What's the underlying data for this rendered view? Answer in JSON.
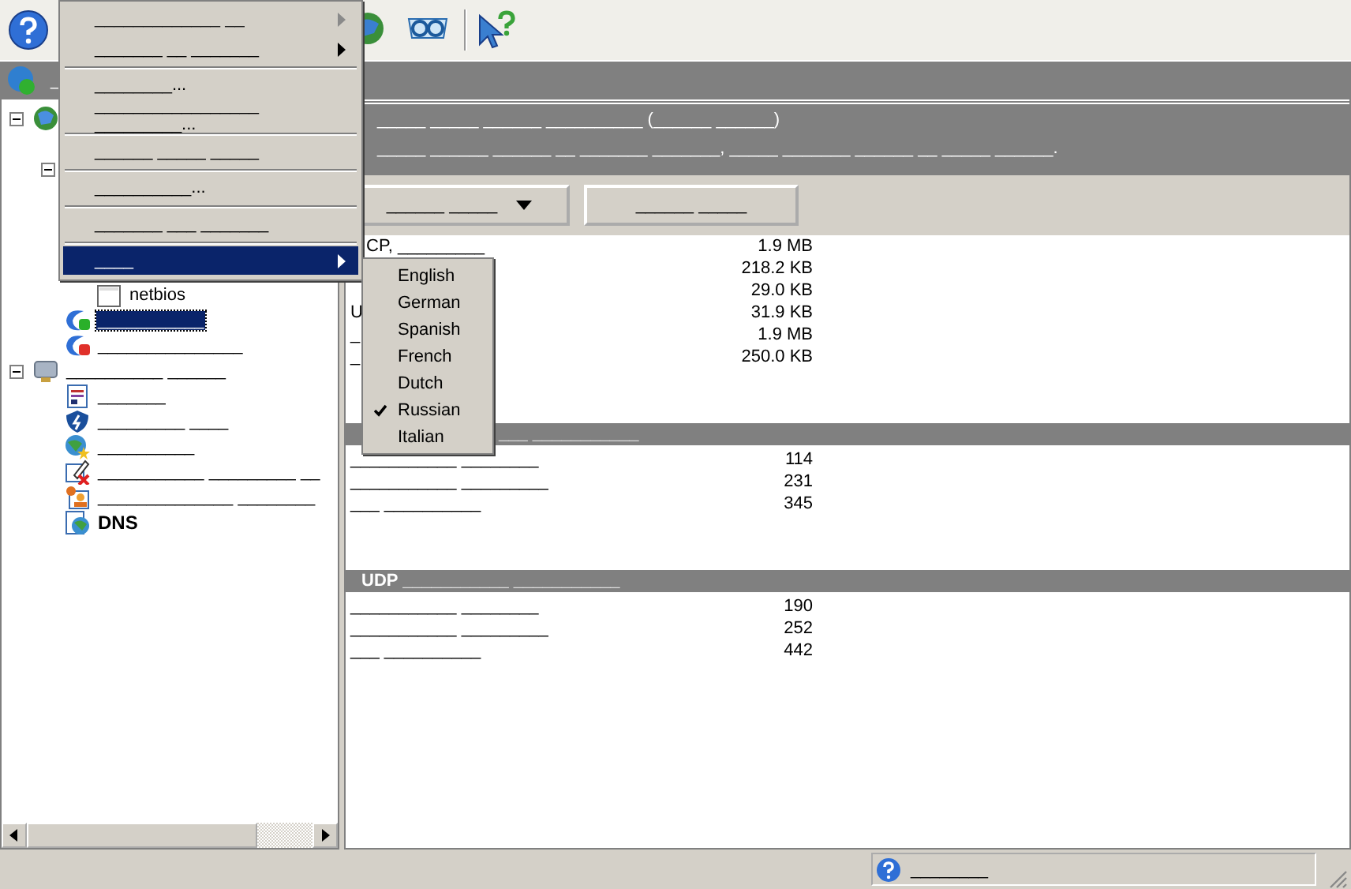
{
  "header_bar": {
    "title": "_"
  },
  "tree": [
    {
      "expanded": true,
      "children": [
        {
          "expanded": true,
          "children": [
            {
              "label": "netbios",
              "selected": false
            }
          ]
        },
        {
          "label": "___________",
          "selected": true
        },
        {
          "label": "_______________",
          "selected": false
        }
      ]
    },
    {
      "label": "__________ ______",
      "selected": false,
      "expanded": true,
      "children": [
        {
          "label": "_______",
          "selected": false
        },
        {
          "label": "_________ ____",
          "selected": false
        },
        {
          "label": "__________",
          "selected": false
        },
        {
          "label": "___________ _________ __",
          "selected": false
        },
        {
          "label": "______________ ________",
          "selected": false
        },
        {
          "label": "DNS",
          "selected": false
        }
      ]
    }
  ],
  "header_lines": [
    "_____ _____ ______ __________ (______ ______)",
    "_____ ______ ______ __ _______ _______, _____ _______ ______ __ _____ ______."
  ],
  "buttons": [
    {
      "label": "______ _____",
      "kind": "dropdown"
    },
    {
      "label": "______ _____",
      "kind": "plain"
    }
  ],
  "sections": [
    {
      "rows": [
        {
          "label": "CP, _________",
          "value": "1.9 MB"
        },
        {
          "value": "218.2 KB"
        },
        {
          "value": "29.0 KB"
        },
        {
          "label": "U",
          "value": "31.9 KB"
        },
        {
          "label": "_",
          "value": "1.9 MB"
        },
        {
          "label": "_",
          "value": "250.0 KB"
        }
      ]
    },
    {
      "title": "___ ___________",
      "rows": [
        {
          "label": "___________ ________",
          "value": "114"
        },
        {
          "label": "___________ _________",
          "value": "231"
        },
        {
          "label": "___ __________",
          "value": "345"
        }
      ]
    },
    {
      "title": "UDP ___________ ___________",
      "rows": [
        {
          "label": "___________ ________",
          "value": "190"
        },
        {
          "label": "___________ _________",
          "value": "252"
        },
        {
          "label": "___ __________",
          "value": "442"
        }
      ]
    }
  ],
  "menu": [
    {
      "kind": "item",
      "label": "_____________ __",
      "submenu": true,
      "disabled": true,
      "selected": false
    },
    {
      "kind": "item",
      "label": "_______ __ _______",
      "submenu": true,
      "disabled": false,
      "selected": false
    },
    {
      "kind": "separator"
    },
    {
      "kind": "item",
      "label": "________...",
      "submenu": false,
      "disabled": false,
      "selected": false
    },
    {
      "kind": "item",
      "label": "_________________ _________...",
      "submenu": false,
      "disabled": false,
      "selected": false
    },
    {
      "kind": "separator"
    },
    {
      "kind": "item",
      "label": "______ _____ _____",
      "submenu": false,
      "disabled": false,
      "selected": false
    },
    {
      "kind": "separator"
    },
    {
      "kind": "item",
      "label": "__________...",
      "submenu": false,
      "disabled": false,
      "selected": false
    },
    {
      "kind": "separator"
    },
    {
      "kind": "item",
      "label": "_______ ___ _______",
      "submenu": false,
      "disabled": false,
      "selected": false
    },
    {
      "kind": "separator"
    },
    {
      "kind": "item",
      "label": "____",
      "submenu": true,
      "disabled": false,
      "selected": true
    }
  ],
  "languages": [
    {
      "label": "English",
      "checked": false
    },
    {
      "label": "German",
      "checked": false
    },
    {
      "label": "Spanish",
      "checked": false
    },
    {
      "label": "French",
      "checked": false
    },
    {
      "label": "Dutch",
      "checked": false
    },
    {
      "label": "Russian",
      "checked": true
    },
    {
      "label": "Italian",
      "checked": false
    }
  ],
  "status": {
    "text": "________"
  }
}
